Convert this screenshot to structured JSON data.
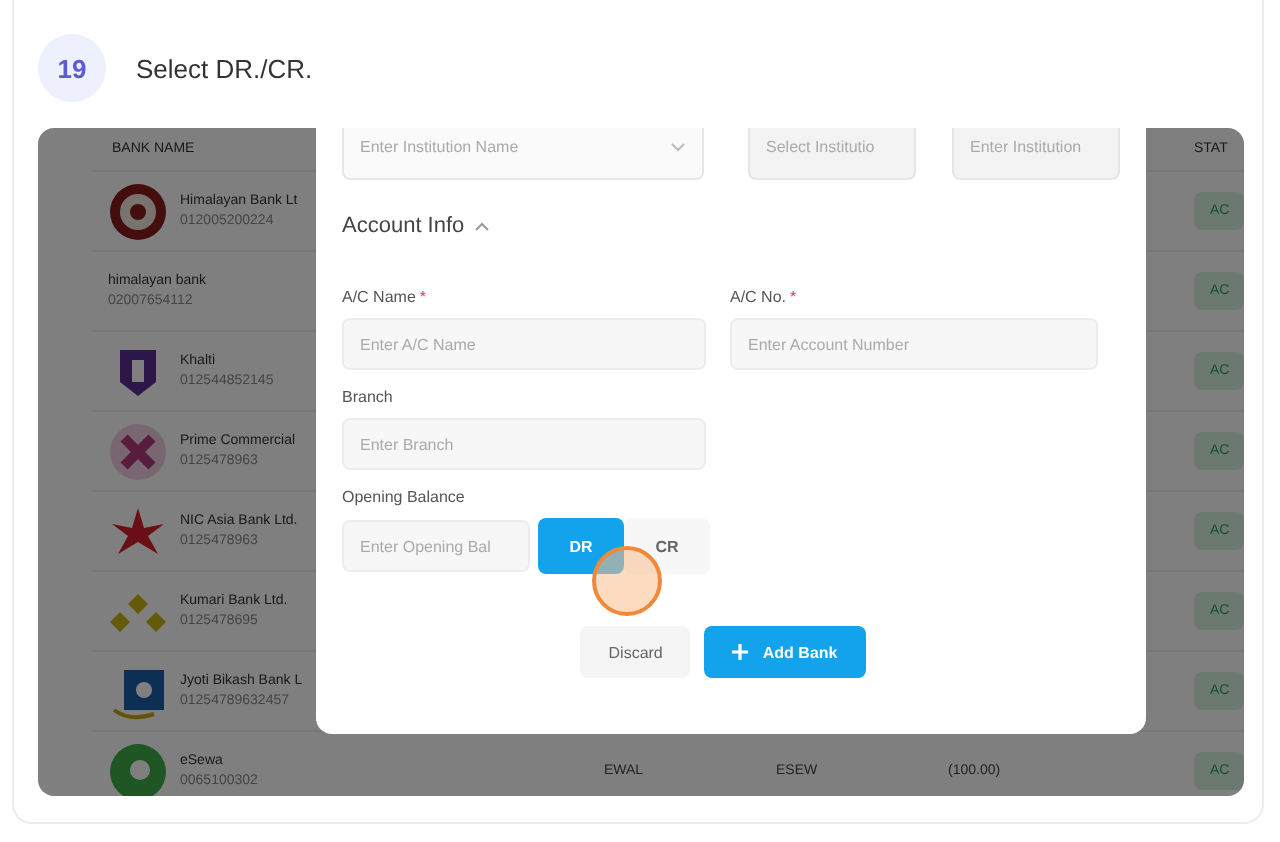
{
  "step": {
    "number": "19",
    "text": "Select DR./CR."
  },
  "table": {
    "columns": [
      {
        "label": "BANK NAME"
      },
      {
        "label": "STAT"
      }
    ],
    "rows": [
      {
        "name": "Himalayan Bank Lt",
        "account": "012005200224",
        "status": "AC"
      },
      {
        "name": "himalayan bank",
        "account": "02007654112",
        "status": "AC"
      },
      {
        "name": "Khalti",
        "account": "012544852145",
        "status": "AC"
      },
      {
        "name": "Prime Commercial",
        "account": "0125478963",
        "status": "AC"
      },
      {
        "name": "NIC Asia Bank Ltd.",
        "account": "0125478963",
        "status": "AC"
      },
      {
        "name": "Kumari Bank Ltd.",
        "account": "0125478695",
        "status": "AC"
      },
      {
        "name": "Jyoti Bikash Bank L",
        "account": "01254789632457",
        "status": "AC"
      },
      {
        "name": "eSewa",
        "account": "0065100302",
        "status": "AC",
        "extra": [
          "EWAL",
          "ESEW",
          "(100.00)"
        ]
      }
    ]
  },
  "modal": {
    "institution_fields": [
      {
        "kind": "select",
        "placeholder": "Enter Institution Name"
      },
      {
        "kind": "input",
        "placeholder": "Select Institutio"
      },
      {
        "kind": "input",
        "placeholder": "Enter Institution"
      }
    ],
    "section": {
      "title": "Account Info",
      "expanded": true
    },
    "fields": [
      {
        "label": "A/C Name",
        "required_mark": "*",
        "placeholder": "Enter A/C Name"
      },
      {
        "label": "A/C No.",
        "required_mark": "*",
        "placeholder": "Enter Account Number"
      },
      {
        "label": "Branch",
        "placeholder": "Enter Branch"
      }
    ],
    "opening_balance": {
      "label": "Opening Balance",
      "placeholder": "Enter Opening Bal",
      "options": [
        {
          "label": "DR",
          "selected": true
        },
        {
          "label": "CR",
          "selected": false
        }
      ]
    },
    "buttons": [
      {
        "kind": "secondary",
        "label": "Discard"
      },
      {
        "kind": "primary",
        "label": "Add Bank"
      }
    ]
  }
}
